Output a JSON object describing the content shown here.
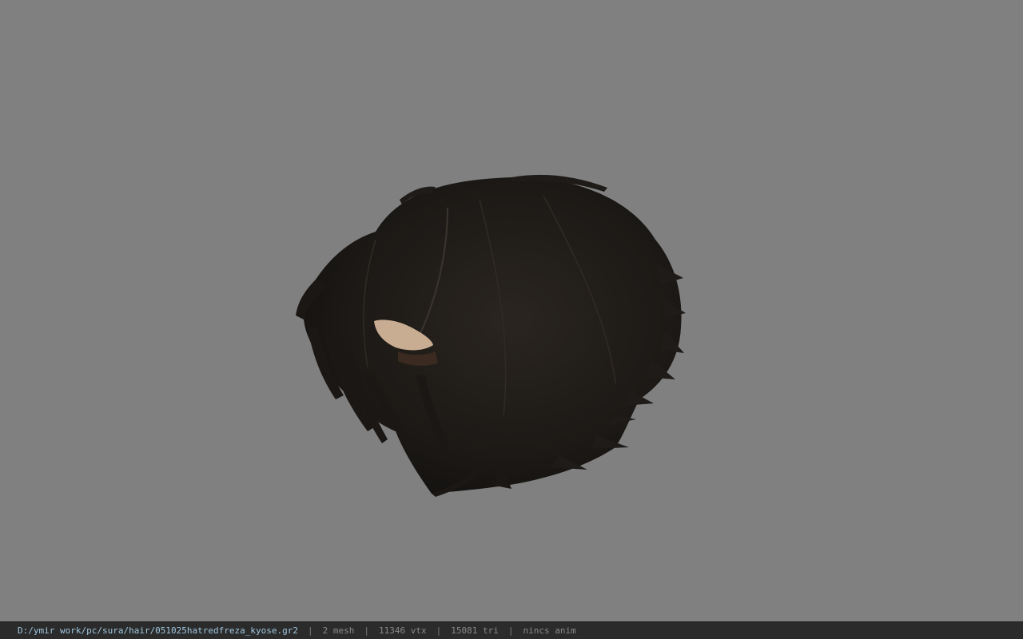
{
  "viewer": {
    "background_color": "#808080",
    "model_icon": "hair-mesh-model"
  },
  "status_bar": {
    "file_path": "D:/ymir work/pc/sura/hair/051025hatredfreza_kyose.gr2",
    "separator": "|",
    "mesh_count": "2 mesh",
    "vertex_count": "11346 vtx",
    "triangle_count": "15081 tri",
    "animation_status": "nincs anim"
  }
}
